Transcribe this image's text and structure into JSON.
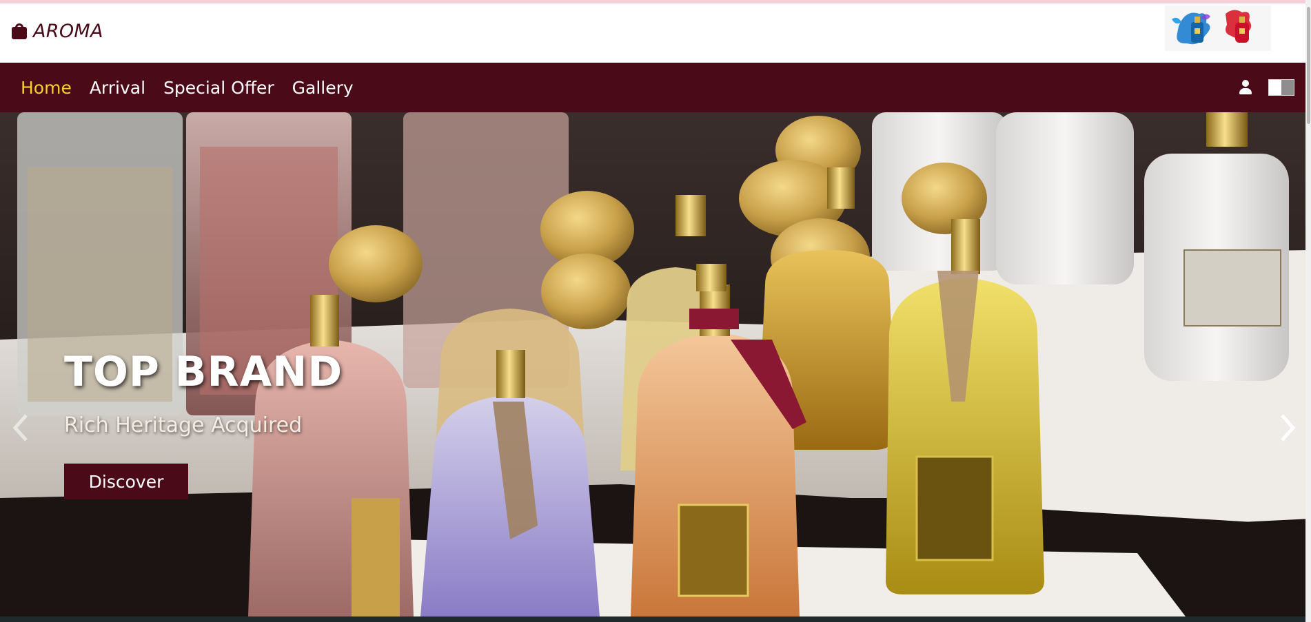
{
  "brand": {
    "name": "AROMA",
    "icon": "shopping-bag-icon"
  },
  "nav": {
    "links": [
      {
        "label": "Home",
        "active": true
      },
      {
        "label": "Arrival",
        "active": false
      },
      {
        "label": "Special Offer",
        "active": false
      },
      {
        "label": "Gallery",
        "active": false
      }
    ],
    "icons": [
      "user-icon",
      "toggle-switch"
    ]
  },
  "hero": {
    "title": "TOP BRAND",
    "subtitle": "Rich Heritage Acquired",
    "cta_label": "Discover",
    "prev_icon": "chevron-left-icon",
    "next_icon": "chevron-right-icon"
  },
  "colors": {
    "brand": "#4a0a17",
    "active_link": "#f6d130",
    "top_strip": "#f6cfd9"
  }
}
